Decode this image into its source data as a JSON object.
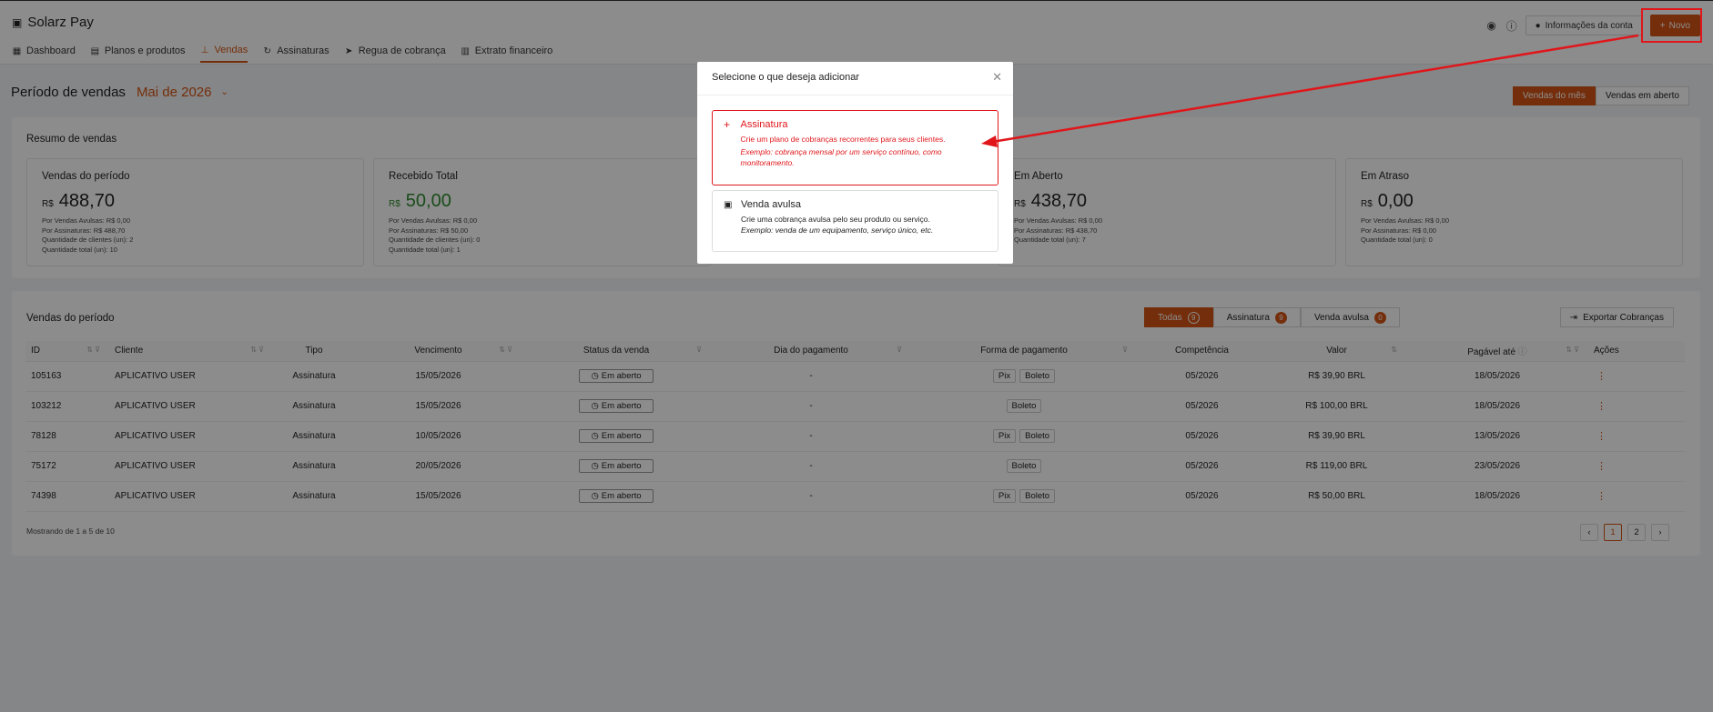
{
  "app": {
    "title": "Solarz Pay"
  },
  "nav": [
    {
      "label": "Dashboard",
      "icon": "dashboard-icon"
    },
    {
      "label": "Planos e produtos",
      "icon": "products-icon"
    },
    {
      "label": "Vendas",
      "icon": "sales-icon",
      "active": true
    },
    {
      "label": "Assinaturas",
      "icon": "refresh-icon"
    },
    {
      "label": "Regua de cobrança",
      "icon": "send-icon"
    },
    {
      "label": "Extrato financeiro",
      "icon": "statement-icon"
    }
  ],
  "header": {
    "account_label": "Informações da conta",
    "new_label": "Novo"
  },
  "period": {
    "label": "Período de vendas",
    "month": "Mai de 2026",
    "toggle": [
      "Vendas do mês",
      "Vendas em aberto"
    ]
  },
  "summary": {
    "title": "Resumo de vendas",
    "stats": [
      {
        "label": "Vendas do período",
        "currency": "R$",
        "value": "488,70",
        "details": [
          "Por Vendas Avulsas: R$ 0,00",
          "Por Assinaturas: R$ 488,70",
          "Quantidade de clientes (un): 2",
          "Quantidade total (un): 10"
        ]
      },
      {
        "label": "Recebido Total",
        "currency": "R$",
        "value": "50,00",
        "details": [
          "Por Vendas Avulsas: R$ 0,00",
          "Por Assinaturas: R$ 50,00",
          "Quantidade de clientes (un): 0",
          "Quantidade total (un): 1"
        ]
      },
      {
        "label": "Em Aberto",
        "currency": "R$",
        "value": "438,70",
        "details": [
          "Por Vendas Avulsas: R$ 0,00",
          "Por Assinaturas: R$ 438,70",
          "Quantidade total (un): 7"
        ]
      },
      {
        "label": "Em Atraso",
        "currency": "R$",
        "value": "0,00",
        "details": [
          "Por Vendas Avulsas: R$ 0,00",
          "Por Assinaturas: R$ 0,00",
          "Quantidade total (un): 0"
        ]
      }
    ]
  },
  "sales": {
    "title": "Vendas do período",
    "tabs": [
      {
        "label": "Todas",
        "count": "9"
      },
      {
        "label": "Assinatura",
        "count": "9"
      },
      {
        "label": "Venda avulsa",
        "count": "0"
      }
    ],
    "export_label": "Exportar Cobranças",
    "columns": [
      "ID",
      "Cliente",
      "Tipo",
      "Vencimento",
      "Status da venda",
      "Dia do pagamento",
      "Forma de pagamento",
      "Competência",
      "Valor",
      "Pagável até",
      "Ações"
    ],
    "rows": [
      {
        "id": "105163",
        "cliente": "APLICATIVO USER",
        "tipo": "Assinatura",
        "vencimento": "15/05/2026",
        "status": "Em aberto",
        "dia": "-",
        "pagamento": [
          "Pix",
          "Boleto"
        ],
        "competencia": "05/2026",
        "valor": "R$ 39,90 BRL",
        "pagavel": "18/05/2026"
      },
      {
        "id": "103212",
        "cliente": "APLICATIVO USER",
        "tipo": "Assinatura",
        "vencimento": "15/05/2026",
        "status": "Em aberto",
        "dia": "-",
        "pagamento": [
          "Boleto"
        ],
        "competencia": "05/2026",
        "valor": "R$ 100,00 BRL",
        "pagavel": "18/05/2026"
      },
      {
        "id": "78128",
        "cliente": "APLICATIVO USER",
        "tipo": "Assinatura",
        "vencimento": "10/05/2026",
        "status": "Em aberto",
        "dia": "-",
        "pagamento": [
          "Pix",
          "Boleto"
        ],
        "competencia": "05/2026",
        "valor": "R$ 39,90 BRL",
        "pagavel": "13/05/2026"
      },
      {
        "id": "75172",
        "cliente": "APLICATIVO USER",
        "tipo": "Assinatura",
        "vencimento": "20/05/2026",
        "status": "Em aberto",
        "dia": "-",
        "pagamento": [
          "Boleto"
        ],
        "competencia": "05/2026",
        "valor": "R$ 119,00 BRL",
        "pagavel": "23/05/2026"
      },
      {
        "id": "74398",
        "cliente": "APLICATIVO USER",
        "tipo": "Assinatura",
        "vencimento": "15/05/2026",
        "status": "Em aberto",
        "dia": "-",
        "pagamento": [
          "Pix",
          "Boleto"
        ],
        "competencia": "05/2026",
        "valor": "R$ 50,00 BRL",
        "pagavel": "18/05/2026"
      }
    ],
    "showing": "Mostrando de 1 a 5 de 10",
    "pages": [
      "1",
      "2"
    ]
  },
  "modal": {
    "title": "Selecione o que deseja adicionar",
    "options": [
      {
        "title": "Assinatura",
        "desc": "Crie um plano de cobranças recorrentes para seus clientes.",
        "example": "Exemplo: cobrança mensal por um serviço contínuo, como monitoramento.",
        "icon": "plus-icon"
      },
      {
        "title": "Venda avulsa",
        "desc": "Crie uma cobrança avulsa pelo seu produto ou serviço.",
        "example": "Exemplo: venda de um equipamento, serviço único, etc.",
        "icon": "single-sale-icon"
      }
    ]
  },
  "colors": {
    "accent": "#d45514",
    "annotation": "#e0161b",
    "positive": "#2e8b2e"
  }
}
